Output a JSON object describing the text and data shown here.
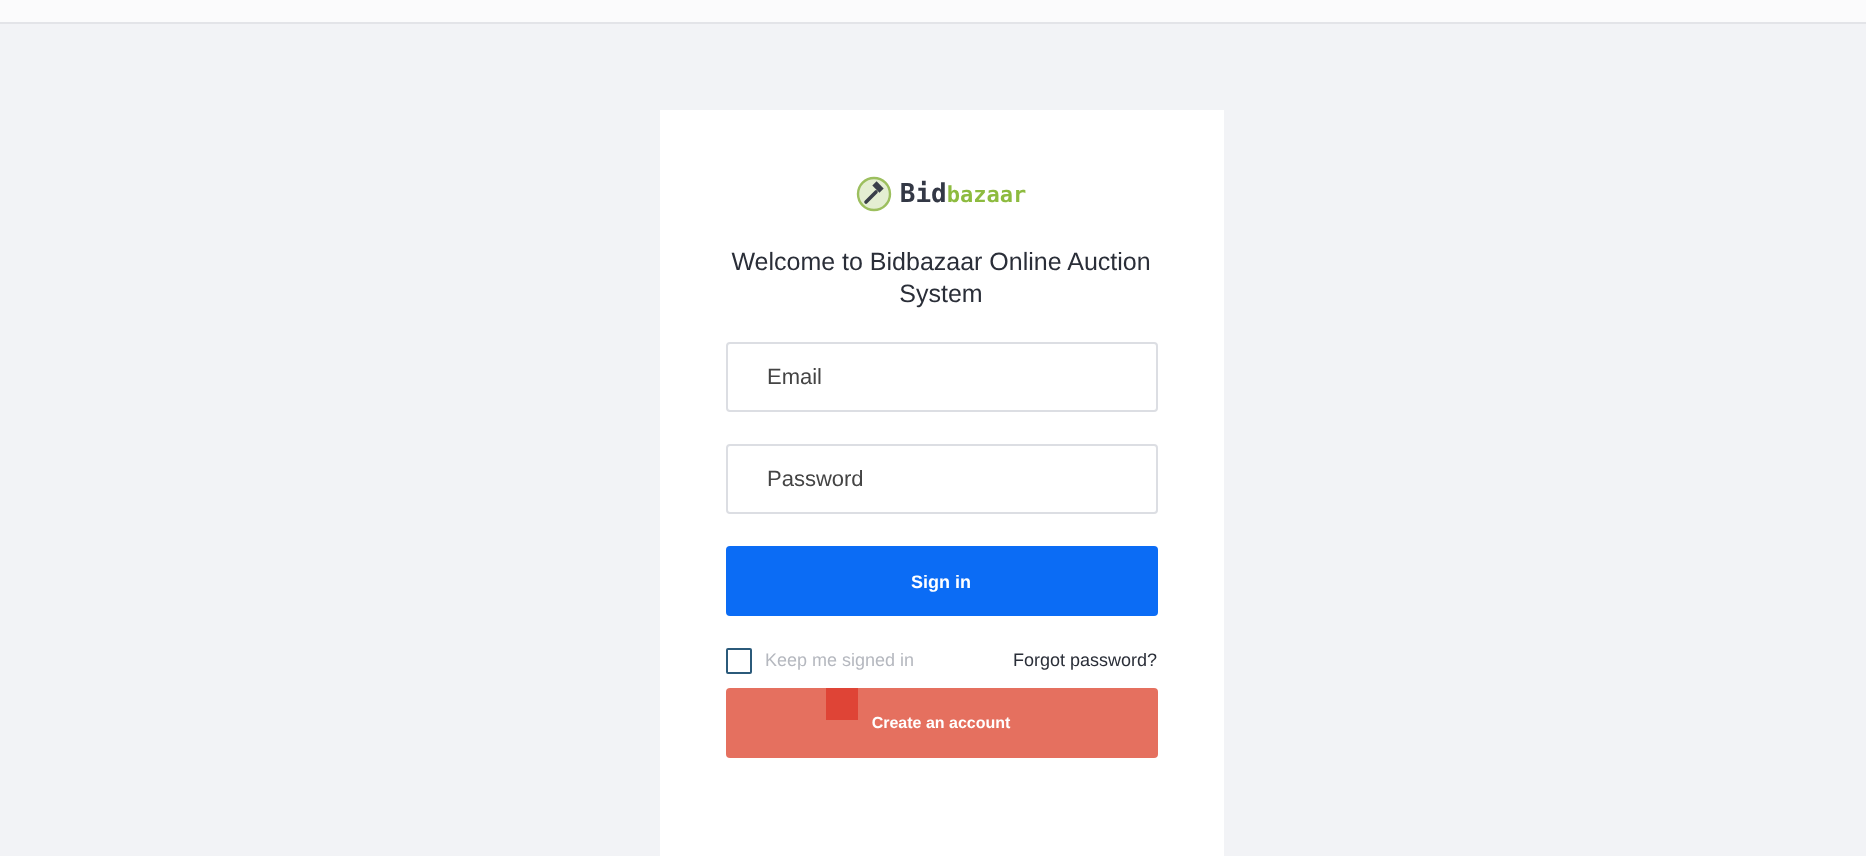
{
  "logo": {
    "name_start": "Bid",
    "name_end": "bazaar"
  },
  "heading": "Welcome to Bidbazaar Online Auction System",
  "fields": [
    {
      "placeholder": "Email"
    },
    {
      "placeholder": "Password"
    }
  ],
  "sign_in_button": "Sign in",
  "remember": {
    "label": "Keep me signed in",
    "checked": false
  },
  "forgot_link": "Forgot password?",
  "create_button": "Create an account"
}
